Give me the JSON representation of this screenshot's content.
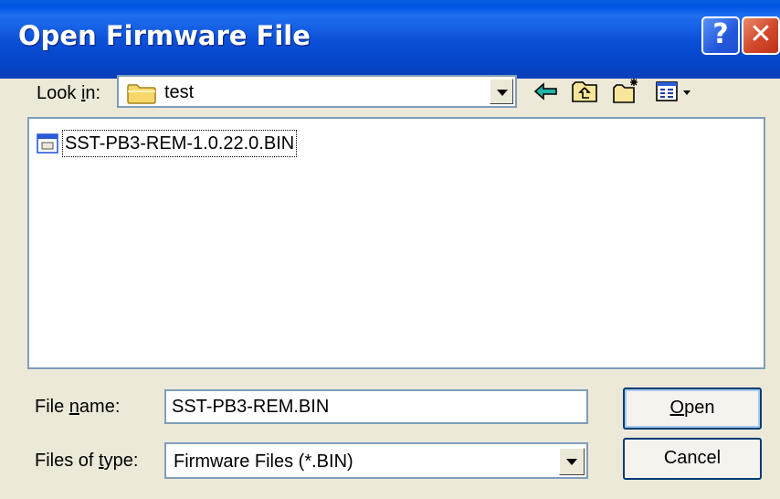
{
  "window": {
    "title": "Open Firmware File",
    "help_glyph": "?",
    "close_glyph": "✕"
  },
  "look_in": {
    "label_pre": "Look ",
    "label_u": "i",
    "label_post": "n:",
    "value": "test",
    "icon": "folder-icon"
  },
  "toolbar": {
    "icons": [
      "back-arrow-icon",
      "up-folder-icon",
      "new-folder-icon",
      "view-menu-icon"
    ]
  },
  "files": [
    {
      "name": "SST-PB3-REM-1.0.22.0.BIN",
      "icon": "binary-file-icon"
    }
  ],
  "filename": {
    "label_pre": "File ",
    "label_u": "n",
    "label_post": "ame:",
    "value": "SST-PB3-REM.BIN"
  },
  "filetype": {
    "label_pre": "Files of ",
    "label_u": "t",
    "label_post": "ype:",
    "value": "Firmware Files (*.BIN)"
  },
  "buttons": {
    "open_u": "O",
    "open_rest": "pen",
    "cancel": "Cancel"
  },
  "colors": {
    "titlebar": "#0054e3",
    "face": "#ece9d8",
    "border": "#7f9db9",
    "close": "#d2462a"
  }
}
